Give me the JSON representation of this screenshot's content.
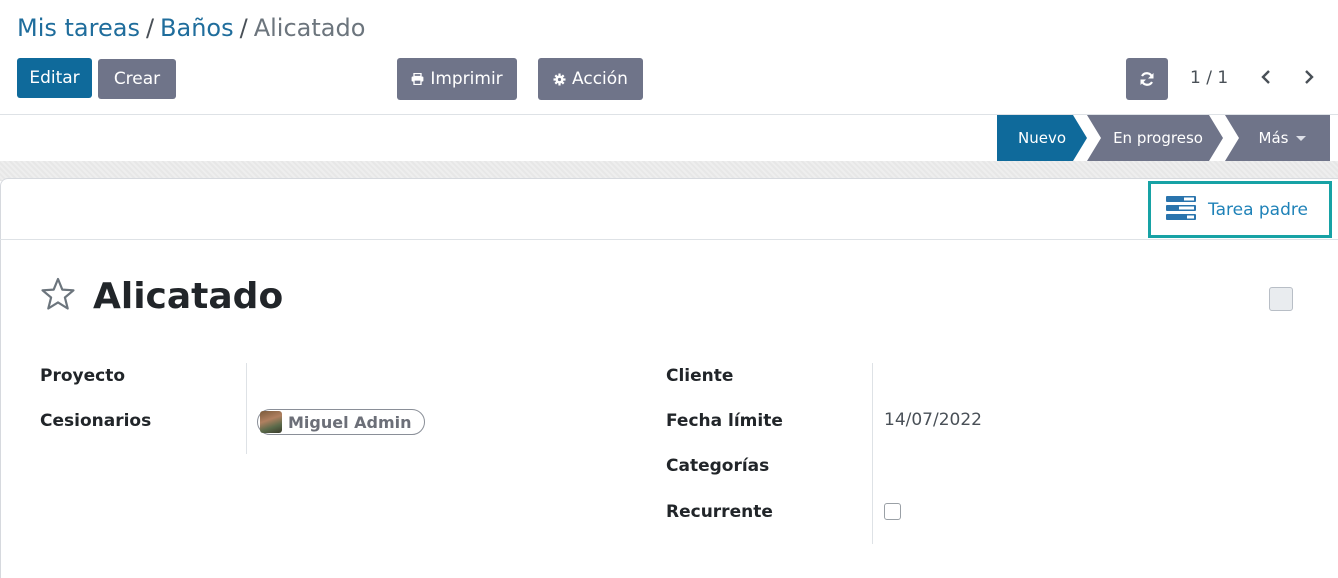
{
  "breadcrumb": {
    "items": [
      "Mis tareas",
      "Baños"
    ],
    "separator": "/",
    "current": "Alicatado"
  },
  "toolbar": {
    "edit_label": "Editar",
    "create_label": "Crear",
    "print_label": "Imprimir",
    "action_label": "Acción",
    "print_icon": "printer-icon",
    "action_icon": "gear-icon"
  },
  "pager": {
    "value": "1 / 1",
    "refresh_icon": "refresh-icon",
    "prev_icon": "chevron-left-icon",
    "next_icon": "chevron-right-icon"
  },
  "statusbar": {
    "stages": [
      "Nuevo",
      "En progreso"
    ],
    "more_label": "Más",
    "active_stage": "Nuevo"
  },
  "smart_button": {
    "label": "Tarea padre",
    "icon": "tasks-icon"
  },
  "task": {
    "title": "Alicatado",
    "favorite_icon": "star-outline-icon",
    "kanban_state": "normal"
  },
  "fields": {
    "left": {
      "project_label": "Proyecto",
      "project_value": "",
      "assignees_label": "Cesionarios",
      "assignee_name": "Miguel Admin"
    },
    "right": {
      "customer_label": "Cliente",
      "customer_value": "",
      "deadline_label": "Fecha límite",
      "deadline_value": "14/07/2022",
      "tags_label": "Categorías",
      "tags_value": "",
      "recurrent_label": "Recurrente",
      "recurrent_checked": false
    }
  },
  "colors": {
    "primary": "#0f6a9b",
    "secondary": "#6f7489",
    "link": "#1f6d9c",
    "highlight_border": "#17a2a5"
  }
}
